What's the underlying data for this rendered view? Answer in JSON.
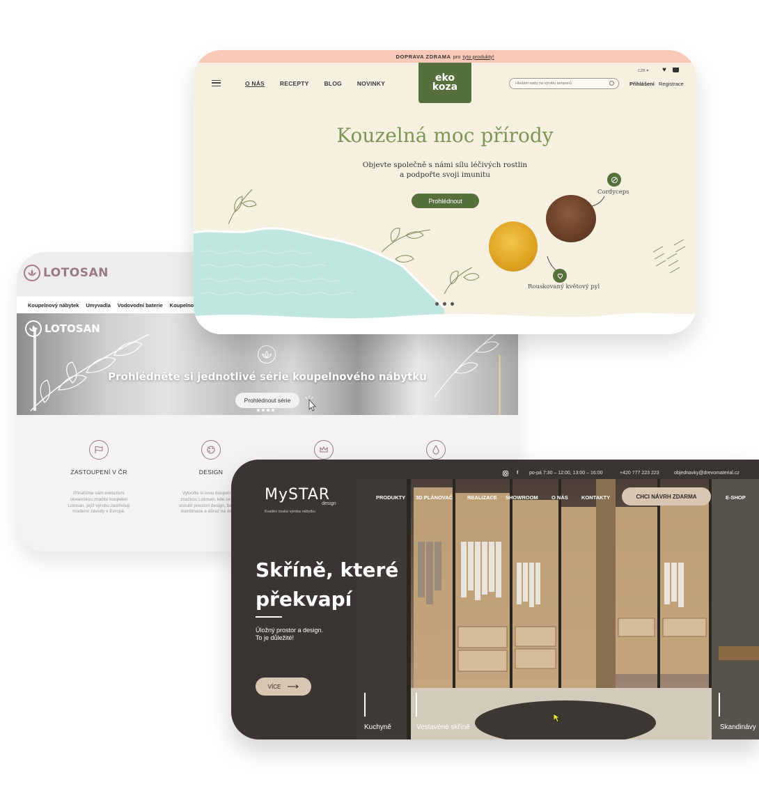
{
  "lotosan": {
    "logo": "LOTOSAN",
    "nav": [
      "Koupelnový nábytek",
      "Umyvadla",
      "Vodovodní baterie",
      "Koupelnov"
    ],
    "hero_logo": "LOTOSAN",
    "hero_title": "Prohlédněte si jednotlivé série koupelnového nábytku",
    "hero_button": "Prohlédnout série",
    "features": [
      {
        "title": "ZASTOUPENÍ V ČR",
        "icon": "flag-icon",
        "text": "Přinášíme vám exkluzivní slovenskou značku koupelen Lotosan, jejíž výrobu zastřešují moderní závody v Evropě."
      },
      {
        "title": "DESIGN",
        "icon": "palette-icon",
        "text": "Vytvořte si svou koupelnu se značkou Lotosan, kde se sobě snoubí precizní design, barevné kombinace a důraz na detaily."
      },
      {
        "title": "",
        "icon": "crown-icon",
        "text": ""
      },
      {
        "title": "",
        "icon": "drop-icon",
        "text": ""
      }
    ]
  },
  "ekokoza": {
    "topbar": {
      "bold": "DOPRAVA ZDRAMA",
      "mid": "pro",
      "link": "tyto produkty!"
    },
    "nav": [
      "O NÁS",
      "RECEPTY",
      "BLOG",
      "NOVINKY"
    ],
    "logo_line1": "eko",
    "logo_line2": "koza",
    "search_placeholder": "Hledám sadu na výrobu tamponů",
    "currency": "CZK ▾",
    "login": "Přihlášení",
    "register": "Registrace",
    "title": "Kouzelná moc přírody",
    "subtitle_line1": "Objevte společně s námi sílu léčivých rostlin",
    "subtitle_line2": "a podpořte svoji imunitu",
    "button": "Prohlédnout",
    "label_cordyceps": "Cordyceps",
    "label_pollen": "Rouskovaný květový pyl",
    "colors": {
      "green": "#56703c",
      "title": "#7d9557",
      "topbar": "#f9c8b6"
    }
  },
  "mystar": {
    "hours": "po-pá 7:30 – 12:00, 13:00 – 16:00",
    "phone": "+420 777 223 223",
    "email": "objednavky@drevomaterial.cz",
    "logo": "MySTAR",
    "logo_sub": "design",
    "logo_tag": "Kvalitní česká výroba nábytku",
    "nav": [
      "PRODUKTY",
      "3D PLÁNOVAČ",
      "REALIZACE",
      "SHOWROOM",
      "O NÁS",
      "KONTAKTY"
    ],
    "cta": "CHCI NÁVRH ZDARMA",
    "eshop": "E-SHOP",
    "headline_line1": "Skříně, které",
    "headline_line2": "překvapí",
    "desc_line1": "Úložný prostor a design.",
    "desc_line2": "To je důležité!",
    "more": "VÍCE",
    "categories": [
      "Kuchyně",
      "Vestavěné skříně",
      "Skandinávy"
    ]
  }
}
